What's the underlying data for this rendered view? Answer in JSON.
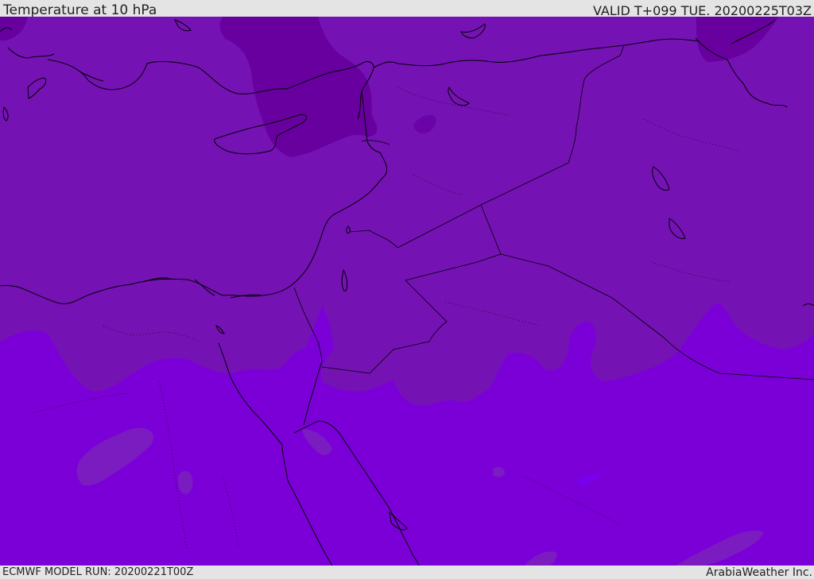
{
  "header": {
    "title": "Temperature at 10 hPa",
    "valid": "VALID T+099 TUE. 20200225T03Z"
  },
  "footer": {
    "model_run": "ECMWF MODEL RUN: 20200221T00Z",
    "credit": "ArabiaWeather Inc."
  },
  "map": {
    "region": "Eastern Mediterranean and Middle East",
    "field": "temperature",
    "level": "10 hPa",
    "colors": {
      "cold_core": "#6800a0",
      "mid_band": "#7512b4",
      "warm_band": "#7b00d8",
      "warm_spot": "#7a1cc0",
      "coastline": "#000000"
    }
  }
}
